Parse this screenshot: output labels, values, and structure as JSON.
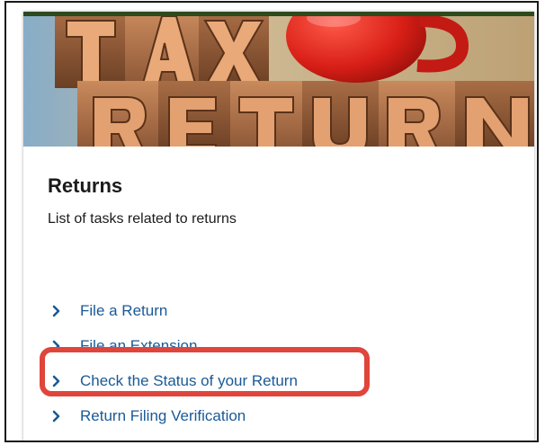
{
  "hero": {
    "image_text_top": "TAX",
    "image_text_bottom": "RETURN"
  },
  "card": {
    "title": "Returns",
    "description": "List of tasks related to returns"
  },
  "tasks": [
    {
      "label": "File a Return",
      "icon": "chevron-right-icon"
    },
    {
      "label": "File an Extension",
      "icon": "chevron-right-icon"
    },
    {
      "label": "Check the Status of your Return",
      "icon": "chevron-right-icon",
      "highlighted": true
    },
    {
      "label": "Return Filing Verification",
      "icon": "chevron-right-icon"
    }
  ],
  "colors": {
    "link": "#1a5a96",
    "highlight": "#e0453b",
    "title": "#1b1b1b"
  }
}
